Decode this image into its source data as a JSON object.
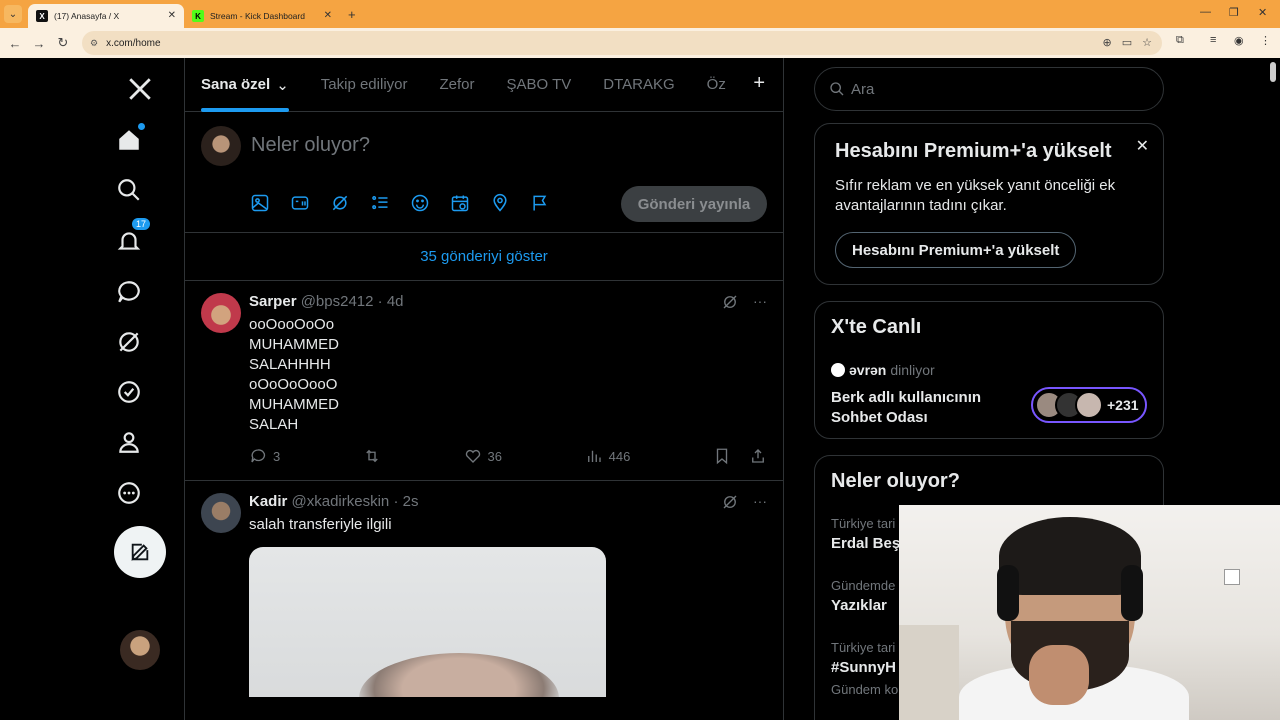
{
  "browser": {
    "tabs": [
      {
        "title": "(17) Anasayfa / X",
        "active": true
      },
      {
        "title": "Stream - Kick Dashboard",
        "active": false
      }
    ],
    "url": "x.com/home"
  },
  "sidebar": {
    "notification_count": "17"
  },
  "feed_tabs": [
    "Sana özel",
    "Takip ediliyor",
    "Zefor",
    "ŞABO TV",
    "DTARAKG",
    "Öz"
  ],
  "composer": {
    "placeholder": "Neler oluyor?",
    "post_label": "Gönderi yayınla"
  },
  "show_more": "35 gönderiyi göster",
  "tweets": [
    {
      "name": "Sarper",
      "handle": "@bps2412",
      "time": "4d",
      "lines": [
        "ooOooOoOo",
        "MUHAMMED",
        "SALAHHHH",
        "oOoOoOooO",
        "MUHAMMED",
        "SALAH"
      ],
      "replies": "3",
      "likes": "36",
      "views": "446"
    },
    {
      "name": "Kadir",
      "handle": "@xkadirkeskin",
      "time": "2s",
      "lines": [
        "salah transferiyle ilgili"
      ]
    }
  ],
  "search": {
    "placeholder": "Ara"
  },
  "premium": {
    "title": "Hesabını Premium+'a yükselt",
    "desc": "Sıfır reklam ve en yüksek yanıt önceliği ek avantajlarının tadını çıkar.",
    "button": "Hesabını Premium+'a yükselt"
  },
  "live": {
    "title": "X'te Canlı",
    "host": "əvrən",
    "host_status": "dinliyor",
    "room": "Berk adlı kullanıcının Sohbet Odası",
    "listeners": "+231",
    "accent": "#7856ff"
  },
  "trends": {
    "title": "Neler oluyor?",
    "items": [
      {
        "context": "Türkiye tari",
        "title": "Erdal Beş"
      },
      {
        "context": "Gündemde",
        "title": "Yazıklar"
      },
      {
        "context": "Türkiye tari",
        "title": "#SunnyH"
      },
      {
        "context": "Gündem ko",
        "title": ""
      }
    ]
  },
  "colors": {
    "accent": "#1d9bf0",
    "bg": "#000000",
    "browser_frame": "#f5a442"
  }
}
